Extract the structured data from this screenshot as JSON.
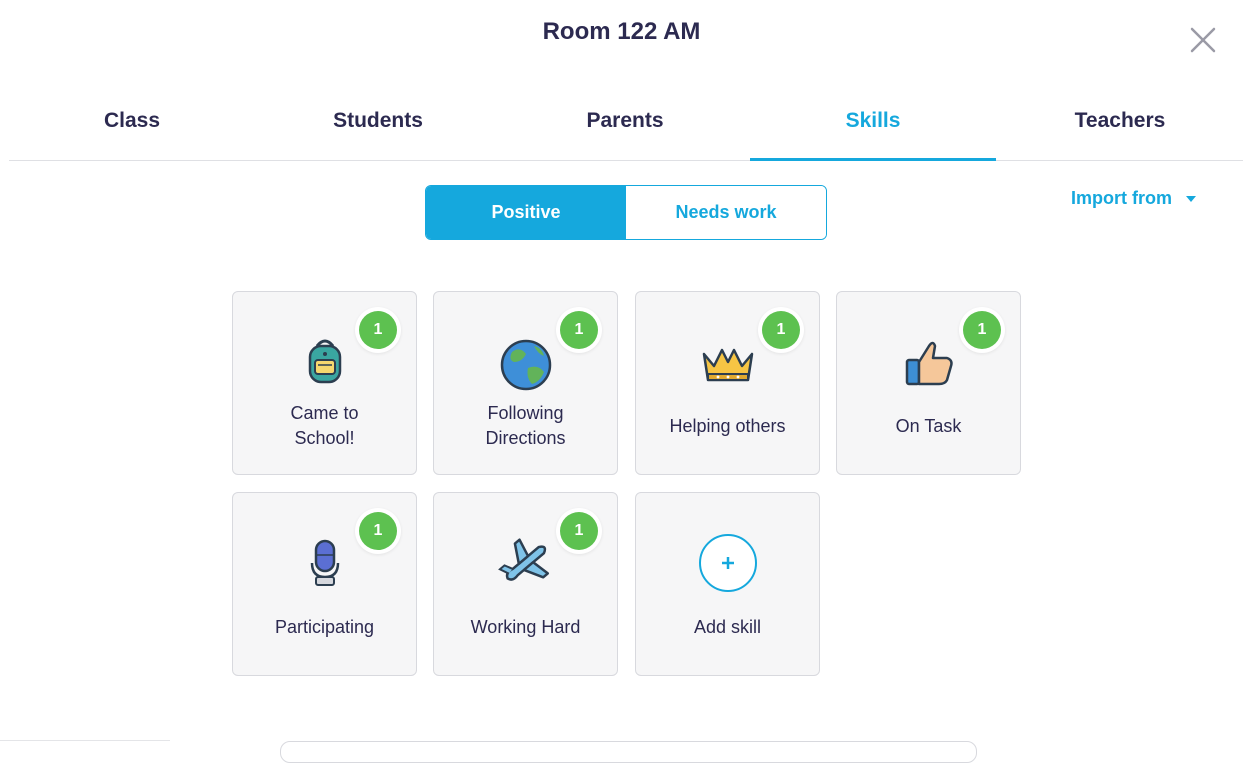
{
  "header": {
    "title": "Room 122 AM"
  },
  "tabs": [
    {
      "label": "Class"
    },
    {
      "label": "Students"
    },
    {
      "label": "Parents"
    },
    {
      "label": "Skills",
      "active": true
    },
    {
      "label": "Teachers"
    }
  ],
  "toggle": {
    "positive": "Positive",
    "needs_work": "Needs work"
  },
  "import_label": "Import from",
  "skills": [
    {
      "line1": "Came to",
      "line2": "School!",
      "count": "1",
      "icon": "backpack-icon"
    },
    {
      "line1": "Following",
      "line2": "Directions",
      "count": "1",
      "icon": "globe-icon"
    },
    {
      "line1": "Helping others",
      "count": "1",
      "icon": "crown-icon"
    },
    {
      "line1": "On Task",
      "count": "1",
      "icon": "thumbs-up-icon"
    },
    {
      "line1": "Participating",
      "count": "1",
      "icon": "microphone-icon"
    },
    {
      "line1": "Working Hard",
      "count": "1",
      "icon": "airplane-icon"
    }
  ],
  "add_skill": "Add skill",
  "colors": {
    "accent": "#15a8dd",
    "badge": "#5dc150",
    "text": "#2c2a50"
  }
}
